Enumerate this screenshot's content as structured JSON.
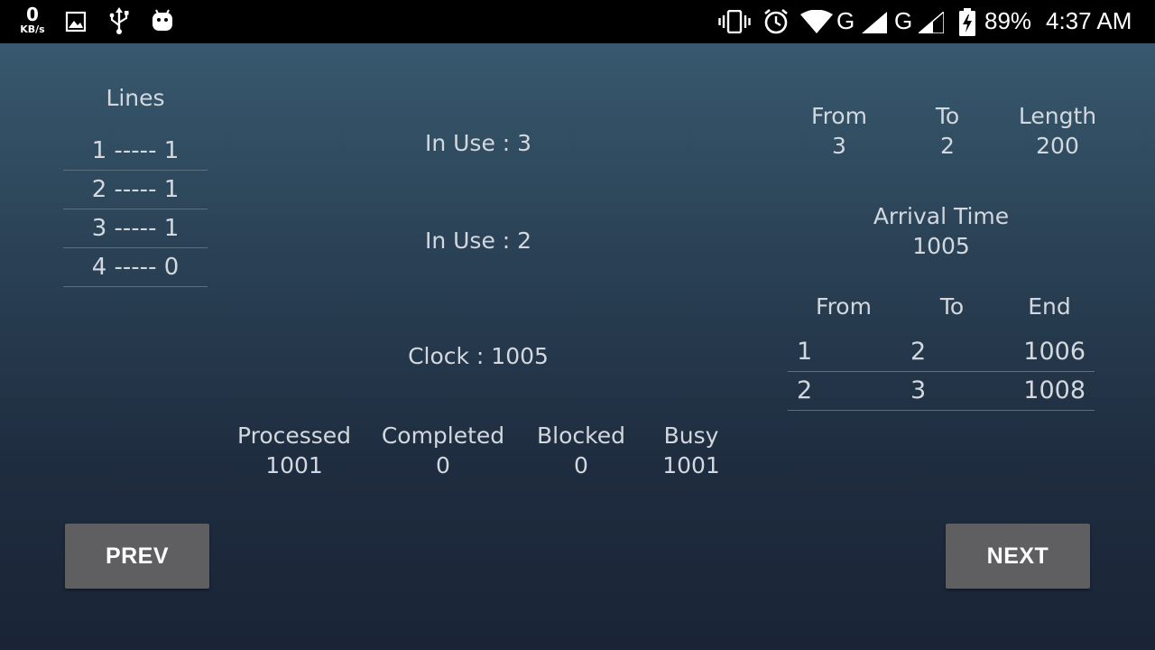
{
  "status_bar": {
    "speed_value": "0",
    "speed_unit": "KB/s",
    "network_1": "G",
    "network_2": "G",
    "battery": "89%",
    "time": "4:37 AM",
    "icons": [
      "gallery-icon",
      "usb-icon",
      "android-icon",
      "vibrate-icon",
      "alarm-icon",
      "wifi-icon",
      "signal-icon",
      "battery-charging-icon"
    ]
  },
  "lines": {
    "title": "Lines",
    "items": [
      "1 ----- 1",
      "2 ----- 1",
      "3 ----- 1",
      "4 ----- 0"
    ]
  },
  "center": {
    "in_use_1": "In Use : 3",
    "in_use_2": "In Use : 2",
    "clock": "Clock : 1005"
  },
  "stats": [
    {
      "label": "Processed",
      "value": "1001"
    },
    {
      "label": "Completed",
      "value": "0"
    },
    {
      "label": "Blocked",
      "value": "0"
    },
    {
      "label": "Busy",
      "value": "1001"
    }
  ],
  "call": {
    "from_label": "From",
    "from_value": "3",
    "to_label": "To",
    "to_value": "2",
    "length_label": "Length",
    "length_value": "200",
    "arrival_label": "Arrival Time",
    "arrival_value": "1005"
  },
  "routes": {
    "headers": [
      "From",
      "To",
      "End"
    ],
    "rows": [
      [
        "1",
        "2",
        "1006"
      ],
      [
        "2",
        "3",
        "1008"
      ]
    ]
  },
  "buttons": {
    "prev": "PREV",
    "next": "NEXT"
  }
}
